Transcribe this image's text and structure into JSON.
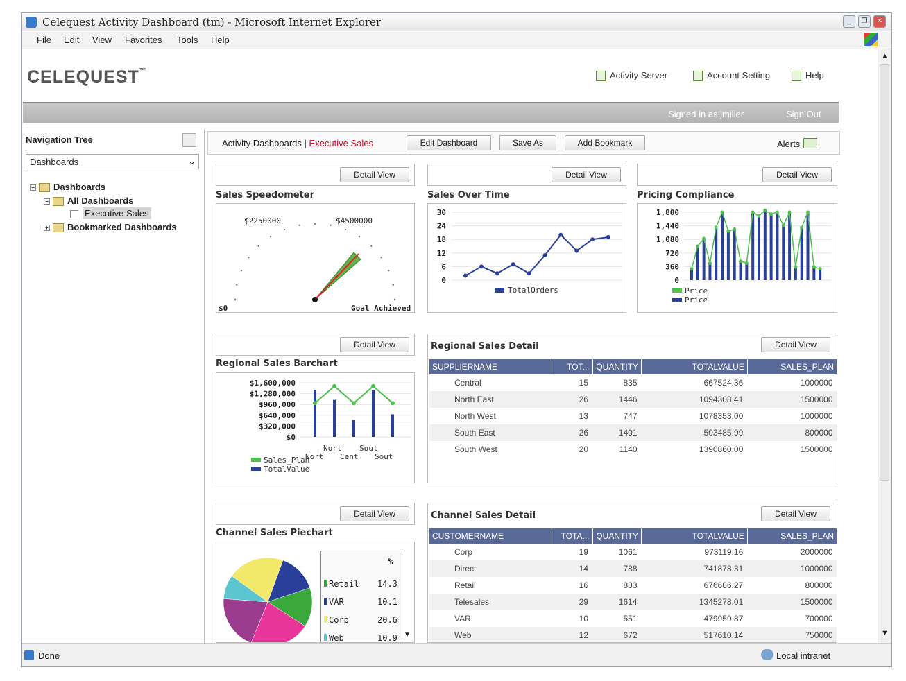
{
  "window": {
    "title": "Celequest Activity Dashboard (tm) - Microsoft Internet Explorer"
  },
  "menu": [
    "File",
    "Edit",
    "View",
    "Favorites",
    "Tools",
    "Help"
  ],
  "header": {
    "logo": "CELEQUEST",
    "logo_mark": "™",
    "links": [
      "Activity Server",
      "Account Setting",
      "Help"
    ],
    "signed_in": "Signed in as jmiller",
    "sign_out": "Sign Out"
  },
  "nav": {
    "title": "Navigation Tree",
    "dropdown": "Dashboards",
    "tree": {
      "root": "Dashboards",
      "all": "All Dashboards",
      "selected": "Executive Sales",
      "bookmarked": "Bookmarked Dashboards"
    }
  },
  "toolbar": {
    "crumb_root": "Activity Dashboards",
    "crumb_sep": "|",
    "crumb_current": "Executive Sales",
    "edit": "Edit Dashboard",
    "save_as": "Save As",
    "bookmark": "Add Bookmark",
    "alerts": "Alerts"
  },
  "detail_view": "Detail View",
  "speedometer": {
    "title": "Sales Speedometer",
    "label1": "$2250000",
    "label2": "$4500000",
    "min": "$0",
    "caption": "Goal Achieved"
  },
  "sales_over_time": {
    "title": "Sales Over Time",
    "chart_data": {
      "type": "line",
      "y_ticks": [
        "30",
        "24",
        "18",
        "12",
        "6",
        "0"
      ],
      "ylim": [
        0,
        30
      ],
      "values": [
        2,
        6,
        3,
        7,
        3,
        11,
        20,
        13,
        18,
        19
      ],
      "legend": "TotalOrders"
    }
  },
  "pricing": {
    "title": "Pricing Compliance",
    "chart_data": {
      "type": "bar",
      "y_ticks": [
        "1,800",
        "1,440",
        "1,080",
        "720",
        "360",
        "0"
      ],
      "ylim": [
        0,
        1800
      ],
      "values": [
        300,
        900,
        1100,
        450,
        1400,
        1800,
        1300,
        1350,
        500,
        450,
        1800,
        1700,
        1850,
        1750,
        1800,
        1450,
        1800,
        350,
        1400,
        1800,
        350,
        300
      ],
      "legend": [
        "Price",
        "Price"
      ]
    }
  },
  "regional_barchart": {
    "title": "Regional Sales Barchart",
    "chart_data": {
      "type": "bar",
      "y_ticks": [
        "$1,600,000",
        "$1,280,000",
        "$960,000",
        "$640,000",
        "$320,000",
        "$0"
      ],
      "ylim": [
        0,
        1600000
      ],
      "values": [
        1390860,
        1094308,
        503486,
        1390860,
        667524
      ],
      "line": [
        1000000,
        1500000,
        1000000,
        1500000,
        1000000
      ],
      "x_labels_top": [
        "Nort",
        "Sout"
      ],
      "x_labels_bottom": [
        "Nort",
        "Cent",
        "Sout"
      ],
      "legend": [
        "Sales_Plan",
        "TotalValue"
      ]
    }
  },
  "regional_detail": {
    "title": "Regional Sales Detail",
    "columns": [
      "SUPPLIERNAME",
      "TOT...",
      "QUANTITY",
      "TOTALVALUE",
      "SALES_PLAN"
    ],
    "rows": [
      [
        "Central",
        "15",
        "835",
        "667524.36",
        "1000000"
      ],
      [
        "North East",
        "26",
        "1446",
        "1094308.41",
        "1500000"
      ],
      [
        "North West",
        "13",
        "747",
        "1078353.00",
        "1000000"
      ],
      [
        "South East",
        "26",
        "1401",
        "503485.99",
        "800000"
      ],
      [
        "South West",
        "20",
        "1140",
        "1390860.00",
        "1500000"
      ]
    ]
  },
  "channel_pie": {
    "title": "Channel Sales Piechart",
    "pct_header": "%",
    "chart_data": {
      "type": "pie",
      "legend": [
        {
          "label": "Retail",
          "value": "14.3",
          "color": "#3aa83a"
        },
        {
          "label": "VAR",
          "value": "10.1",
          "color": "#2a3f9a"
        },
        {
          "label": "Corp",
          "value": "20.6",
          "color": "#f2e96a"
        },
        {
          "label": "Web",
          "value": "10.9",
          "color": "#5cc6d0"
        }
      ]
    }
  },
  "channel_detail": {
    "title": "Channel Sales Detail",
    "columns": [
      "CUSTOMERNAME",
      "TOTA...",
      "QUANTITY",
      "TOTALVALUE",
      "SALES_PLAN"
    ],
    "rows": [
      [
        "Corp",
        "19",
        "1061",
        "973119.16",
        "2000000"
      ],
      [
        "Direct",
        "14",
        "788",
        "741878.31",
        "1000000"
      ],
      [
        "Retail",
        "16",
        "883",
        "676686.27",
        "800000"
      ],
      [
        "Telesales",
        "29",
        "1614",
        "1345278.01",
        "1500000"
      ],
      [
        "VAR",
        "10",
        "551",
        "479959.87",
        "700000"
      ],
      [
        "Web",
        "12",
        "672",
        "517610.14",
        "750000"
      ]
    ]
  },
  "status": {
    "left": "Done",
    "right": "Local intranet"
  }
}
